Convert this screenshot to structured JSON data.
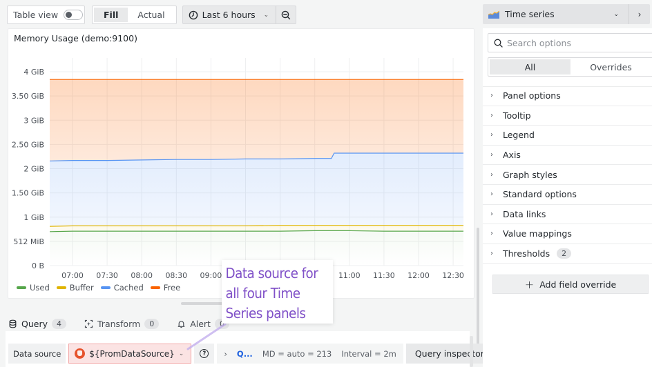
{
  "toolbar": {
    "table_view_label": "Table view",
    "table_view_on": false,
    "fill_label": "Fill",
    "actual_label": "Actual",
    "time_range": "Last 6 hours"
  },
  "panel": {
    "title": "Memory Usage (demo:9100)"
  },
  "chart_data": {
    "type": "area",
    "title": "Memory Usage (demo:9100)",
    "stacked": true,
    "x": [
      "06:40",
      "07:00",
      "07:30",
      "08:00",
      "08:30",
      "09:00",
      "09:30",
      "10:00",
      "10:30",
      "11:00",
      "11:30",
      "12:00",
      "12:30"
    ],
    "x_tick_labels": [
      "07:00",
      "07:30",
      "08:00",
      "08:30",
      "09:00",
      "09:30",
      "10:00",
      "10:30",
      "11:00",
      "11:30",
      "12:00",
      "12:30"
    ],
    "y_tick_labels": [
      "0 B",
      "512 MiB",
      "1 GiB",
      "1.50 GiB",
      "2 GiB",
      "2.50 GiB",
      "3 GiB",
      "3.50 GiB",
      "4 GiB"
    ],
    "y_unit": "GiB",
    "ylim": [
      0,
      4
    ],
    "grid": true,
    "legend_position": "bottom-left",
    "series": [
      {
        "name": "Used",
        "color": "#56a64b",
        "cumulative_values": [
          0.7,
          0.71,
          0.71,
          0.71,
          0.71,
          0.71,
          0.71,
          0.71,
          0.72,
          0.72,
          0.71,
          0.71,
          0.71
        ]
      },
      {
        "name": "Buffer",
        "color": "#e0b400",
        "cumulative_values": [
          0.81,
          0.82,
          0.82,
          0.82,
          0.82,
          0.82,
          0.82,
          0.83,
          0.83,
          0.83,
          0.83,
          0.83,
          0.83
        ]
      },
      {
        "name": "Cached",
        "color": "#5794f2",
        "cumulative_values": [
          2.16,
          2.17,
          2.17,
          2.18,
          2.19,
          2.19,
          2.2,
          2.2,
          2.21,
          2.32,
          2.32,
          2.32,
          2.32
        ]
      },
      {
        "name": "Free",
        "color": "#fa6400",
        "cumulative_values": [
          3.84,
          3.84,
          3.84,
          3.84,
          3.84,
          3.84,
          3.84,
          3.84,
          3.84,
          3.84,
          3.84,
          3.84,
          3.84
        ]
      }
    ]
  },
  "query_tabs": [
    {
      "label": "Query",
      "count": "4",
      "icon": "database-icon"
    },
    {
      "label": "Transform",
      "count": "0",
      "icon": "transform-icon"
    },
    {
      "label": "Alert",
      "count": "0",
      "icon": "bell-icon"
    }
  ],
  "query_row": {
    "data_source_label": "Data source",
    "data_source_value": "${PromDataSource}",
    "query_options_link": "Q...",
    "md": "MD = auto = 213",
    "interval": "Interval = 2m",
    "query_inspector": "Query inspector"
  },
  "annotation": {
    "text": "Data source for all four Time Series panels"
  },
  "options_pane": {
    "viz_type": "Time series",
    "search_placeholder": "Search options",
    "tabs": [
      "All",
      "Overrides"
    ],
    "sections": [
      {
        "label": "Panel options"
      },
      {
        "label": "Tooltip"
      },
      {
        "label": "Legend"
      },
      {
        "label": "Axis"
      },
      {
        "label": "Graph styles"
      },
      {
        "label": "Standard options"
      },
      {
        "label": "Data links"
      },
      {
        "label": "Value mappings"
      },
      {
        "label": "Thresholds",
        "badge": "2"
      }
    ],
    "add_override_label": "Add field override"
  }
}
